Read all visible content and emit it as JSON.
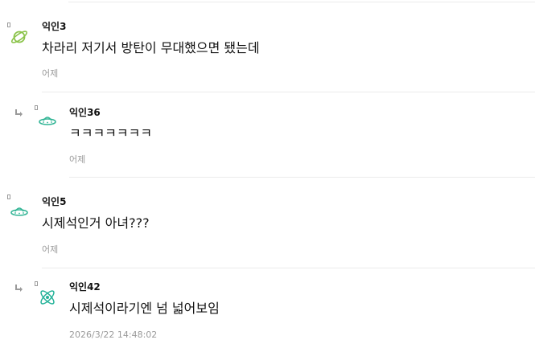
{
  "comments": [
    {
      "author": "익인3",
      "text": "차라리 저기서 방탄이 무대했으면 됐는데",
      "time": "어제",
      "icon": "planet-icon",
      "icon_color": "#8bc34a"
    },
    {
      "author": "익인36",
      "text": "ㅋㅋㅋㅋㅋㅋㅋ",
      "time": "어제",
      "icon": "ufo-icon",
      "icon_color": "#33b596"
    },
    {
      "author": "익인5",
      "text": "시제석인거 아녀???",
      "time": "어제",
      "icon": "ufo-icon",
      "icon_color": "#33b596"
    },
    {
      "author": "익인42",
      "text": "시제석이라기엔 넘 넓어보임",
      "time": "2026/3/22 14:48:02",
      "icon": "atom-icon",
      "icon_color": "#26b39a"
    }
  ]
}
